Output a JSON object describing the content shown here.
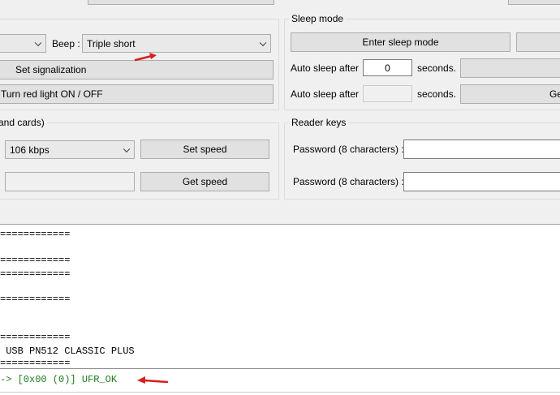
{
  "signalization": {
    "beep_label": "Beep :",
    "light_combo_value": "",
    "beep_combo_value": "Triple short",
    "set_button": "Set signalization",
    "red_light_button": "Turn red light ON / OFF"
  },
  "sleep": {
    "title": "Sleep mode",
    "enter_button": "Enter sleep mode",
    "auto_sleep_label_1": "Auto sleep after",
    "auto_sleep_value_1": "0",
    "seconds_1": "seconds.",
    "auto_sleep_label_2": "Auto sleep after",
    "auto_sleep_value_2": "",
    "seconds_2": "seconds.",
    "get_button_partial": "Ge"
  },
  "speed": {
    "title": "and cards)",
    "combo_value": "106 kbps",
    "set_button": "Set speed",
    "get_field_value": "",
    "get_button": "Get speed"
  },
  "reader_keys": {
    "title": "Reader keys",
    "password_label_1": "Password (8 characters) :",
    "password_label_2": "Password (8 characters) :"
  },
  "console": {
    "lines": [
      "============",
      "============",
      "============",
      "============",
      "============",
      " USB PN512 CLASSIC PLUS",
      "============"
    ]
  },
  "status": {
    "text": "-> [0x00 (0)] UFR_OK",
    "color": "#1e7a1e"
  },
  "colors": {
    "annotation_arrow": "#d61f1f"
  },
  "icons": [
    "chevron-down-icon",
    "red-arrow-annotation"
  ]
}
